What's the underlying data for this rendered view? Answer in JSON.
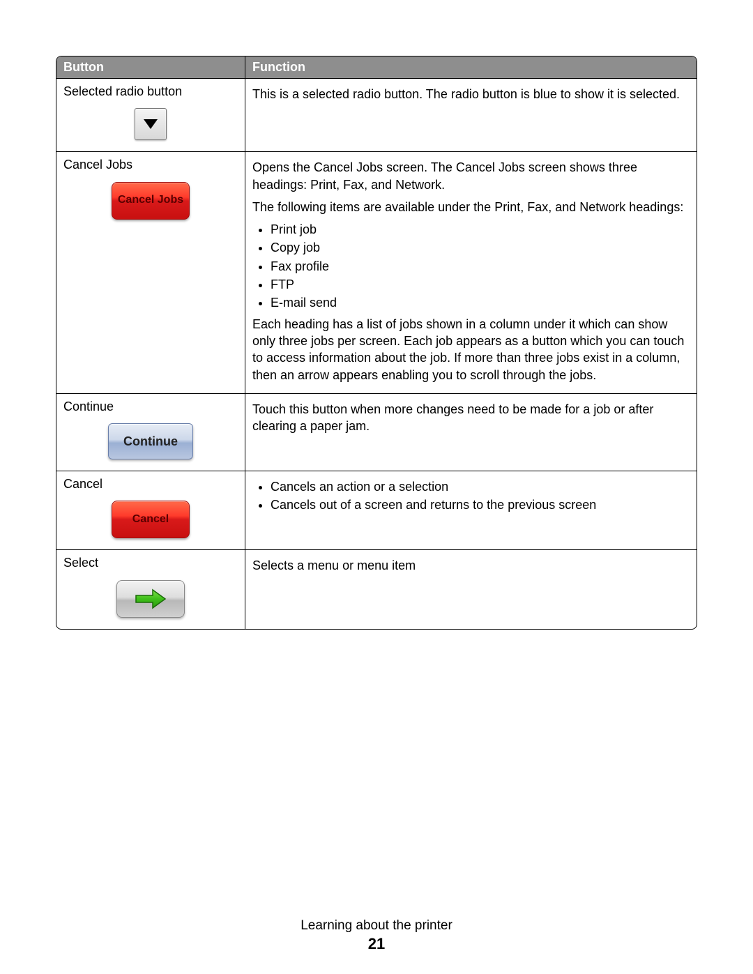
{
  "table": {
    "headers": {
      "button": "Button",
      "function": "Function"
    },
    "rows": {
      "selected_radio": {
        "label": "Selected radio button",
        "desc": "This is a selected radio button. The radio button is blue to show it is selected."
      },
      "cancel_jobs": {
        "label": "Cancel Jobs",
        "btn_text": "Cancel Jobs",
        "p1": "Opens the Cancel Jobs screen. The Cancel Jobs screen shows three headings: Print, Fax, and Network.",
        "p2": "The following items are available under the Print, Fax, and Network headings:",
        "items": [
          "Print job",
          "Copy job",
          "Fax profile",
          "FTP",
          "E-mail send"
        ],
        "p3": "Each heading has a list of jobs shown in a column under it which can show only three jobs per screen. Each job appears as a button which you can touch to access information about the job. If more than three jobs exist in a column, then an arrow appears enabling you to scroll through the jobs."
      },
      "continue": {
        "label": "Continue",
        "btn_text": "Continue",
        "desc": "Touch this button when more changes need to be made for a job or after clearing a paper jam."
      },
      "cancel": {
        "label": "Cancel",
        "btn_text": "Cancel",
        "items": [
          "Cancels an action or a selection",
          "Cancels out of a screen and returns to the previous screen"
        ]
      },
      "select": {
        "label": "Select",
        "desc": "Selects a menu or menu item"
      }
    }
  },
  "footer": {
    "section": "Learning about the printer",
    "page": "21"
  }
}
